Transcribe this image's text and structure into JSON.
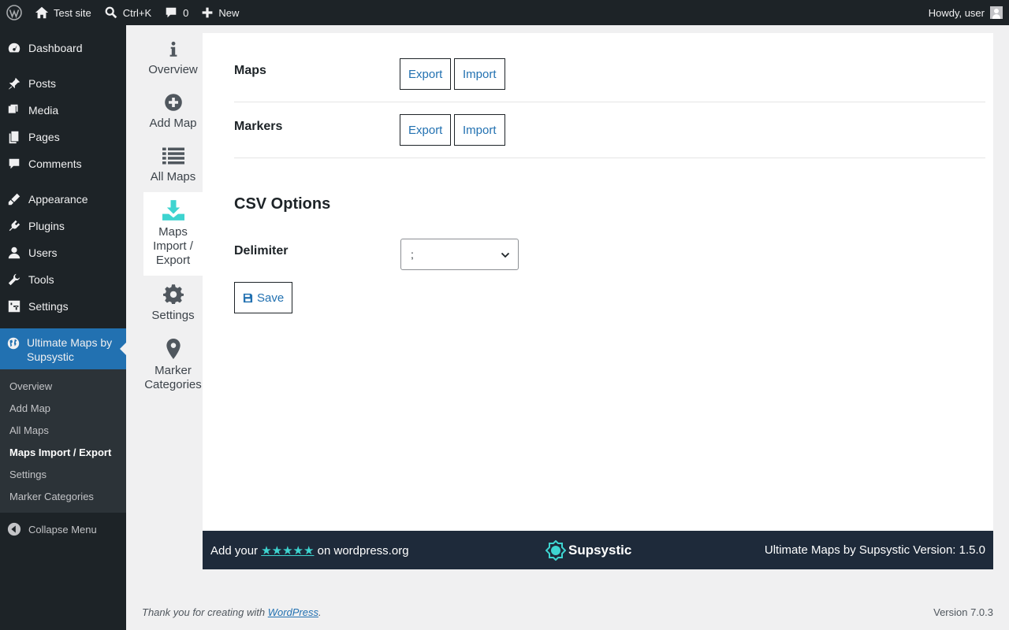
{
  "adminbar": {
    "site_name": "Test site",
    "search_shortcut": "Ctrl+K",
    "comments_count": "0",
    "new_label": "New",
    "howdy": "Howdy, user"
  },
  "menu": {
    "items": [
      {
        "label": "Dashboard",
        "icon": "dashboard-icon"
      },
      {
        "label": "Posts",
        "icon": "pin-icon"
      },
      {
        "label": "Media",
        "icon": "media-icon"
      },
      {
        "label": "Pages",
        "icon": "pages-icon"
      },
      {
        "label": "Comments",
        "icon": "comment-icon"
      },
      {
        "label": "Appearance",
        "icon": "brush-icon"
      },
      {
        "label": "Plugins",
        "icon": "plug-icon"
      },
      {
        "label": "Users",
        "icon": "user-icon"
      },
      {
        "label": "Tools",
        "icon": "wrench-icon"
      },
      {
        "label": "Settings",
        "icon": "sliders-icon"
      }
    ],
    "current_label": "Ultimate Maps by Supsystic",
    "submenu": [
      "Overview",
      "Add Map",
      "All Maps",
      "Maps Import / Export",
      "Settings",
      "Marker Categories"
    ],
    "collapse_label": "Collapse Menu"
  },
  "plugin_nav": [
    "Overview",
    "Add Map",
    "All Maps",
    "Maps Import / Export",
    "Settings",
    "Marker Categories"
  ],
  "main": {
    "maps_label": "Maps",
    "markers_label": "Markers",
    "export_label": "Export",
    "import_label": "Import",
    "csv_heading": "CSV Options",
    "delimiter_label": "Delimiter",
    "delimiter_value": ";",
    "save_label": "Save"
  },
  "plugin_footer": {
    "add_your": "Add your",
    "stars": "★★★★★",
    "on_wporg": "on wordpress.org",
    "brand": "Supsystic",
    "version": "Ultimate Maps by Supsystic Version: 1.5.0"
  },
  "wp_footer": {
    "thanks": "Thank you for creating with",
    "wp_link": "WordPress",
    "period": ".",
    "version": "Version 7.0.3"
  },
  "colors": {
    "accent": "#2271b1",
    "teal": "#3ed4d0",
    "adminbar": "#1d2327"
  }
}
